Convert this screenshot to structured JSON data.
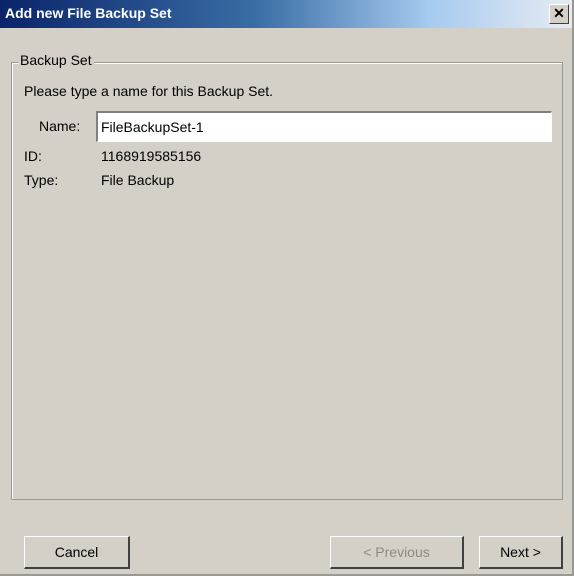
{
  "window": {
    "title": "Add new File Backup Set",
    "close_glyph": "✕",
    "close_icon": "close-icon"
  },
  "group": {
    "legend": "Backup Set",
    "prompt": "Please type a name for this Backup Set.",
    "name_label": "Name:",
    "name_value": "FileBackupSet-1",
    "id_label": "ID:",
    "id_value": "1168919585156",
    "type_label": "Type:",
    "type_value": "File Backup"
  },
  "buttons": {
    "cancel": "Cancel",
    "previous": "< Previous",
    "next": "Next >"
  },
  "colors": {
    "title_bar_start": "#0a246a",
    "dialog_face": "#d4d0c8",
    "disabled_text": "#8c8a85"
  }
}
